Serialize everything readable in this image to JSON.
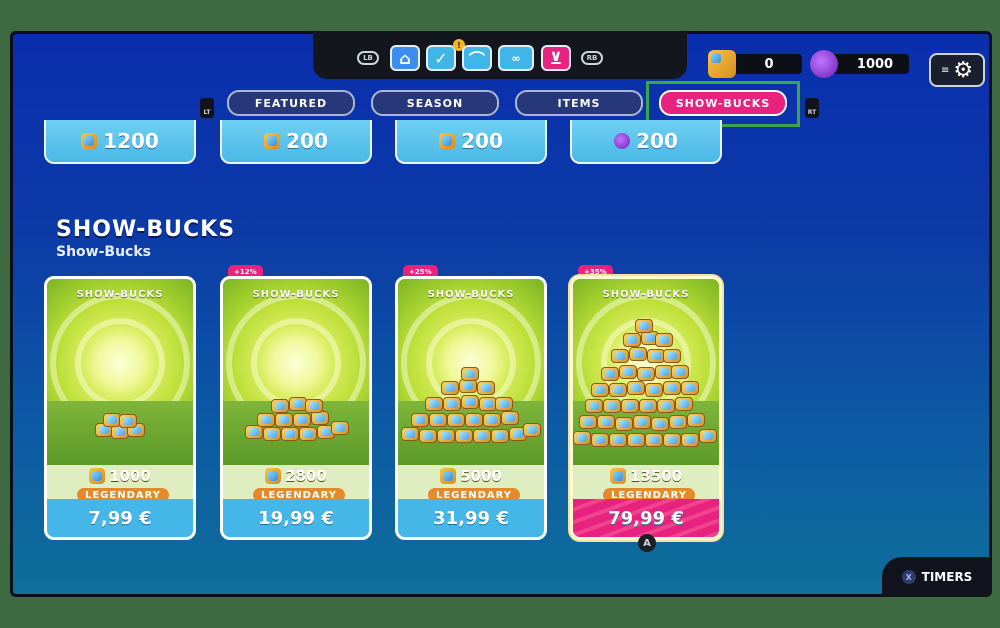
{
  "topnav": {
    "lb": "LB",
    "rb": "RB",
    "icons": [
      "home-icon",
      "shield-check-icon",
      "hanger-icon",
      "pass-icon",
      "cart-icon"
    ],
    "notification": "!"
  },
  "currencies": [
    {
      "icon": "show-bucks-icon",
      "value": "0"
    },
    {
      "icon": "crown-shard-icon",
      "value": "1000"
    }
  ],
  "tabs": [
    {
      "label": "FEATURED",
      "active": false
    },
    {
      "label": "SEASON",
      "active": false
    },
    {
      "label": "ITEMS",
      "active": false
    },
    {
      "label": "SHOW-BUCKS",
      "active": true
    }
  ],
  "triggers": {
    "lt": "LT",
    "rt": "RT"
  },
  "previous_row": [
    {
      "icon": "show-bucks-icon",
      "amount": "1200"
    },
    {
      "icon": "show-bucks-icon",
      "amount": "200"
    },
    {
      "icon": "show-bucks-icon",
      "amount": "200"
    },
    {
      "icon": "crown-shard-icon",
      "amount": "200"
    }
  ],
  "section": {
    "title": "SHOW-BUCKS",
    "subtitle": "Show-Bucks"
  },
  "cards": [
    {
      "label": "SHOW-BUCKS",
      "bonus": "",
      "amount": "1000",
      "rarity": "LEGENDARY",
      "price": "7,99 €"
    },
    {
      "label": "SHOW-BUCKS",
      "bonus": "+12%",
      "amount": "2800",
      "rarity": "LEGENDARY",
      "price": "19,99 €"
    },
    {
      "label": "SHOW-BUCKS",
      "bonus": "+25%",
      "amount": "5000",
      "rarity": "LEGENDARY",
      "price": "31,99 €"
    },
    {
      "label": "SHOW-BUCKS",
      "bonus": "+35%",
      "amount": "13500",
      "rarity": "LEGENDARY",
      "price": "79,99 €"
    }
  ],
  "prompts": {
    "a": "A",
    "x": "X",
    "timers": "TIMERS"
  },
  "colors": {
    "accent": "#e8237f",
    "highlight": "#3aa64a",
    "background": "#0c3aa7"
  }
}
